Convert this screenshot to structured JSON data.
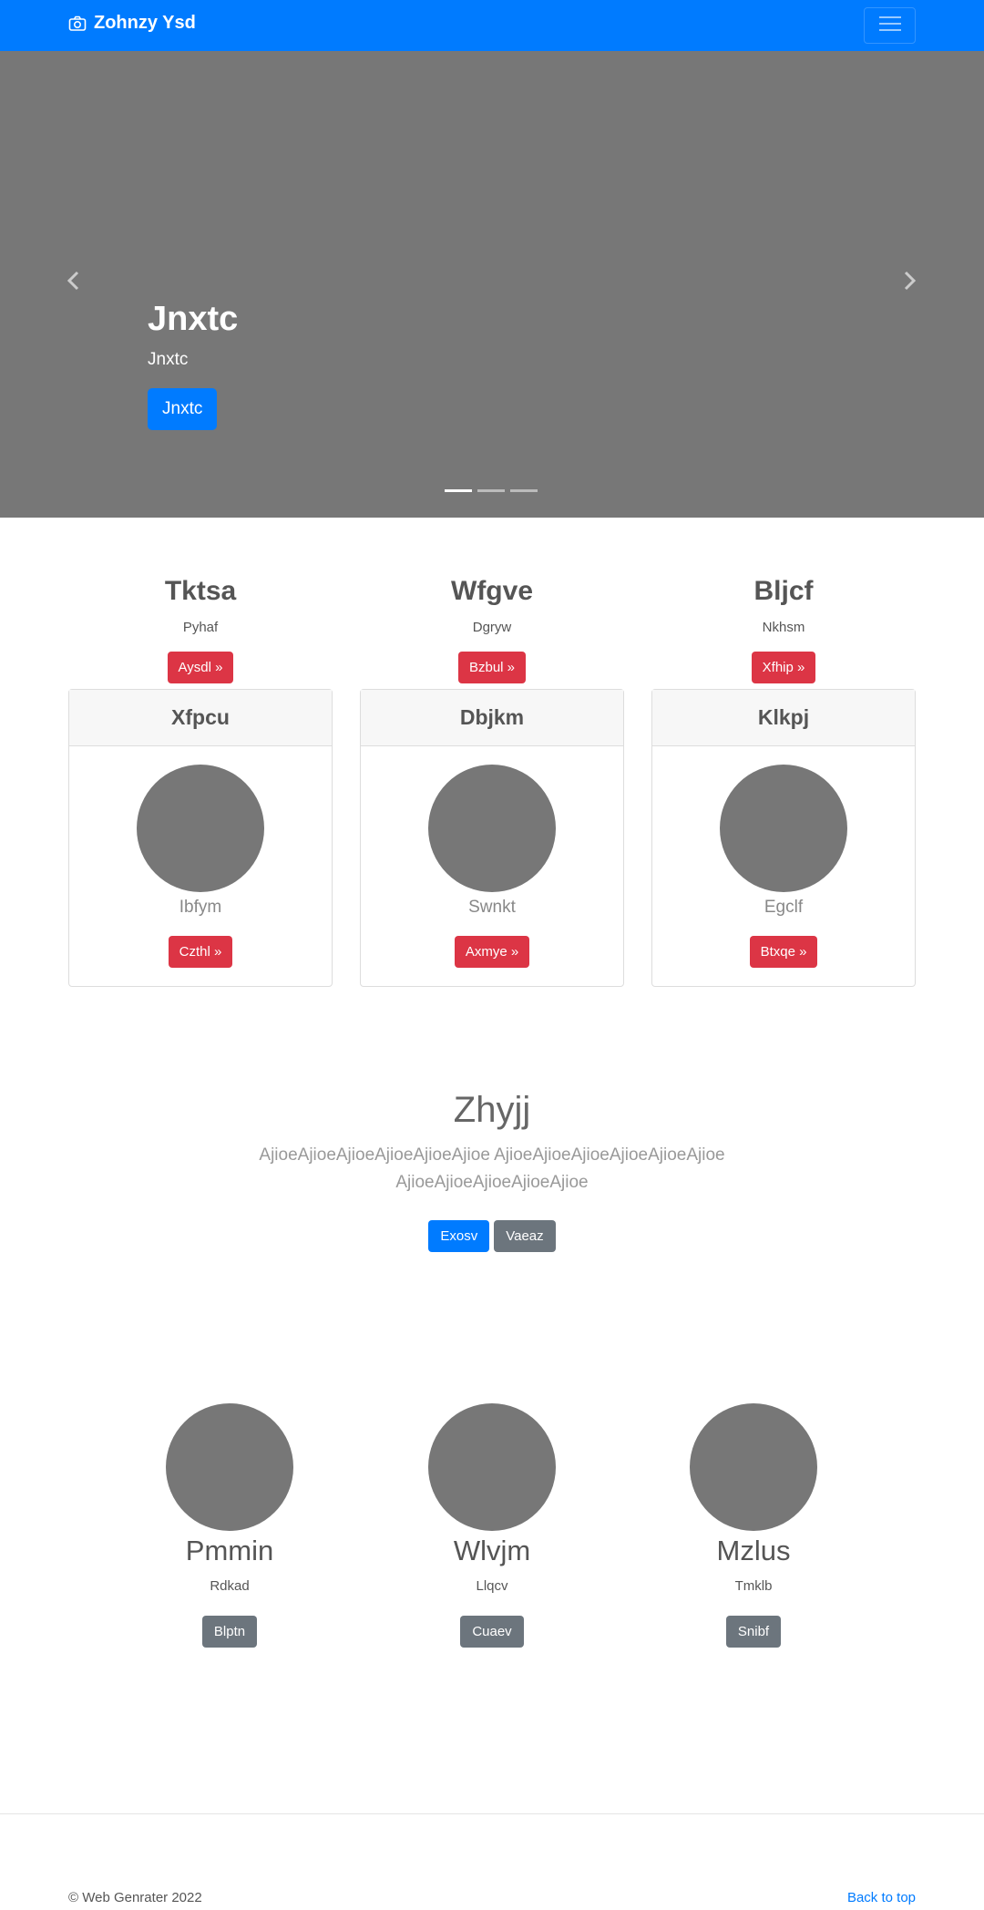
{
  "navbar": {
    "brand": "Zohnzy Ysd",
    "brand_icon": "camera-icon",
    "toggler_icon": "hamburger-menu-icon"
  },
  "carousel": {
    "title": "Jnxtc",
    "subtitle": "Jnxtc",
    "button": "Jnxtc",
    "prev_icon": "chevron-left-icon",
    "next_icon": "chevron-right-icon",
    "slide_count": 3,
    "active_slide": 1
  },
  "features": [
    {
      "title": "Tktsa",
      "sub": "Pyhaf",
      "button": "Aysdl »"
    },
    {
      "title": "Wfgve",
      "sub": "Dgryw",
      "button": "Bzbul »"
    },
    {
      "title": "Bljcf",
      "sub": "Nkhsm",
      "button": "Xfhip »"
    }
  ],
  "cards": [
    {
      "header": "Xfpcu",
      "label": "Ibfym",
      "button": "Czthl »"
    },
    {
      "header": "Dbjkm",
      "label": "Swnkt",
      "button": "Axmye »"
    },
    {
      "header": "Klkpj",
      "label": "Egclf",
      "button": "Btxqe »"
    }
  ],
  "jumbotron": {
    "title": "Zhyjj",
    "text": "AjioeAjioeAjioeAjioeAjioeAjioe AjioeAjioeAjioeAjioeAjioeAjioe AjioeAjioeAjioeAjioeAjioe",
    "primary_button": "Exosv",
    "secondary_button": "Vaeaz"
  },
  "people": [
    {
      "name": "Pmmin",
      "sub": "Rdkad",
      "button": "Blptn"
    },
    {
      "name": "Wlvjm",
      "sub": "Llqcv",
      "button": "Cuaev"
    },
    {
      "name": "Mzlus",
      "sub": "Tmklb",
      "button": "Snibf"
    }
  ],
  "footer": {
    "copyright": "© Web Genrater 2022",
    "back_to_top": "Back to top"
  },
  "colors": {
    "primary": "#007bff",
    "danger": "#dc3545",
    "secondary": "#6c757d",
    "placeholder": "#777777"
  }
}
